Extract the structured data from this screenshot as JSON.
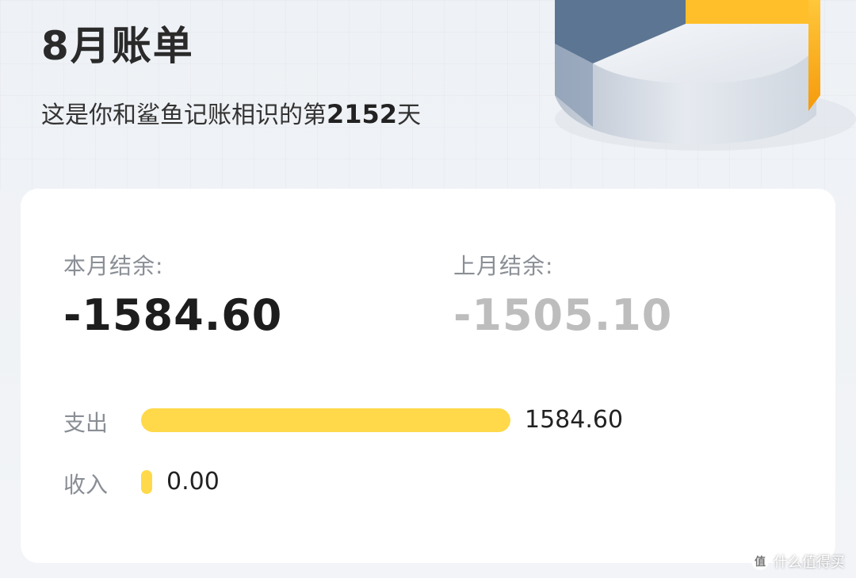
{
  "header": {
    "title": "8月账单",
    "subtitle_prefix": "这是你和鲨鱼记账相识的第",
    "subtitle_days": "2152",
    "subtitle_suffix": "天"
  },
  "summary": {
    "current_label": "本月结余:",
    "current_value": "-1584.60",
    "previous_label": "上月结余:",
    "previous_value": "-1505.10"
  },
  "breakdown": [
    {
      "label": "支出",
      "value": "1584.60",
      "fraction": 1.0
    },
    {
      "label": "收入",
      "value": "0.00",
      "fraction": 0.0
    }
  ],
  "colors": {
    "bar": "#ffd94a",
    "pie_gray": "#dfe3ea",
    "pie_blue": "#5c7592",
    "pie_orange": "#ffb21a"
  },
  "watermark": {
    "badge": "值",
    "text": "什么值得买"
  }
}
